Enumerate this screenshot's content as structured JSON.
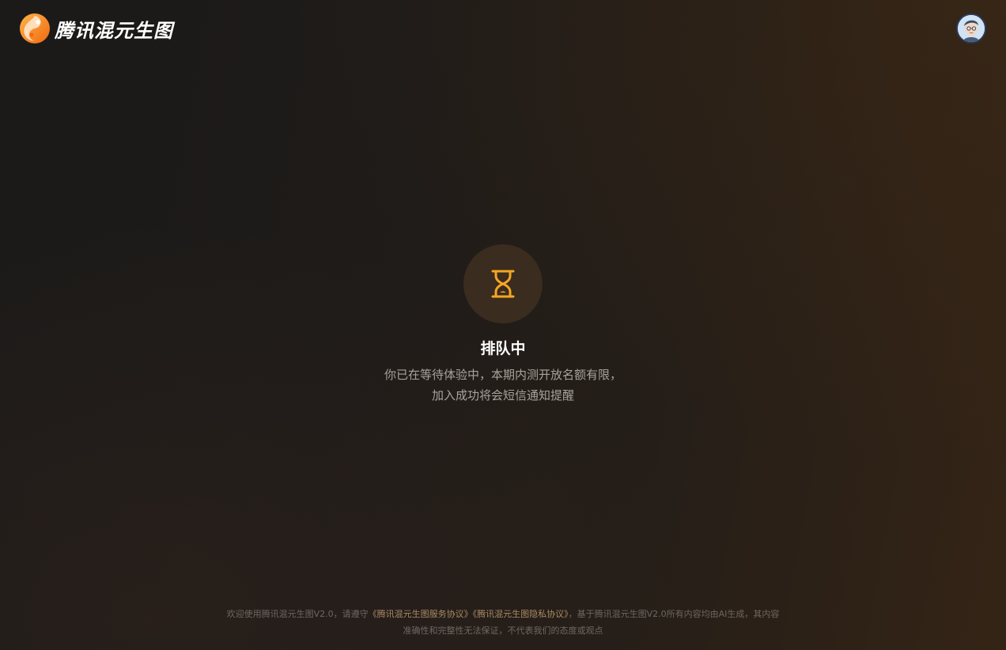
{
  "header": {
    "logo_icon": "hunyuan-logo-icon",
    "logo_text": "腾讯混元生图",
    "avatar_icon": "user-avatar-icon"
  },
  "status": {
    "icon": "hourglass-icon",
    "title": "排队中",
    "desc_line1": "你已在等待体验中，本期内测开放名额有限，",
    "desc_line2": "加入成功将会短信通知提醒"
  },
  "footer": {
    "text_before": "欢迎使用腾讯混元生图V2.0，请遵守",
    "terms_link": "《腾讯混元生图服务协议》",
    "privacy_link": "《腾讯混元生图隐私协议》",
    "text_after": "，基于腾讯混元生图V2.0所有内容均由AI生成，其内容",
    "line2": "准确性和完整性无法保证，不代表我们的态度或观点"
  },
  "colors": {
    "accent": "#f5a623",
    "background_start": "#1b1a19",
    "background_end": "#342416",
    "link": "#a98a66"
  }
}
